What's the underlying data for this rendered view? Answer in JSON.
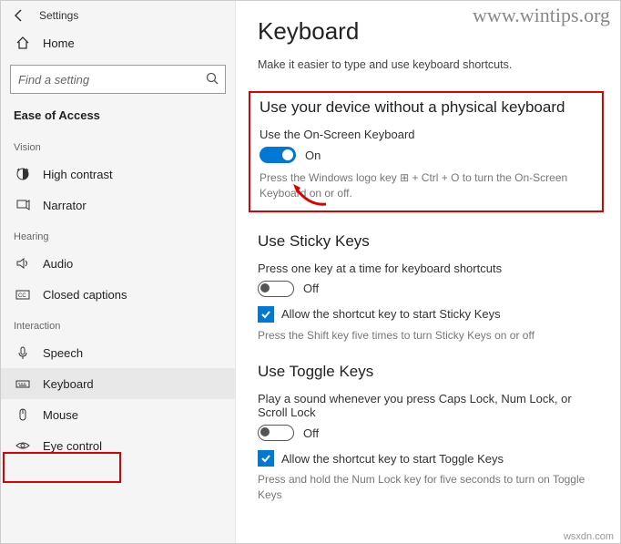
{
  "header": {
    "title": "Settings"
  },
  "home": {
    "label": "Home"
  },
  "search": {
    "placeholder": "Find a setting"
  },
  "sidebar_section": "Ease of Access",
  "groups": {
    "vision": {
      "label": "Vision",
      "items": [
        "High contrast",
        "Narrator"
      ]
    },
    "hearing": {
      "label": "Hearing",
      "items": [
        "Audio",
        "Closed captions"
      ]
    },
    "interaction": {
      "label": "Interaction",
      "items": [
        "Speech",
        "Keyboard",
        "Mouse",
        "Eye control"
      ]
    }
  },
  "main": {
    "title": "Keyboard",
    "subtitle": "Make it easier to type and use keyboard shortcuts.",
    "section_osk": {
      "heading": "Use your device without a physical keyboard",
      "label": "Use the On-Screen Keyboard",
      "state": "On",
      "hint": "Press the Windows logo key ⊞ + Ctrl + O to turn the On-Screen Keyboard on or off."
    },
    "section_sticky": {
      "heading": "Use Sticky Keys",
      "label": "Press one key at a time for keyboard shortcuts",
      "state": "Off",
      "checkbox_label": "Allow the shortcut key to start Sticky Keys",
      "hint": "Press the Shift key five times to turn Sticky Keys on or off"
    },
    "section_toggle": {
      "heading": "Use Toggle Keys",
      "label": "Play a sound whenever you press Caps Lock, Num Lock, or Scroll Lock",
      "state": "Off",
      "checkbox_label": "Allow the shortcut key to start Toggle Keys",
      "hint": "Press and hold the Num Lock key for five seconds to turn on Toggle Keys"
    }
  },
  "watermark1": "www.wintips.org",
  "watermark2": "wsxdn.com"
}
